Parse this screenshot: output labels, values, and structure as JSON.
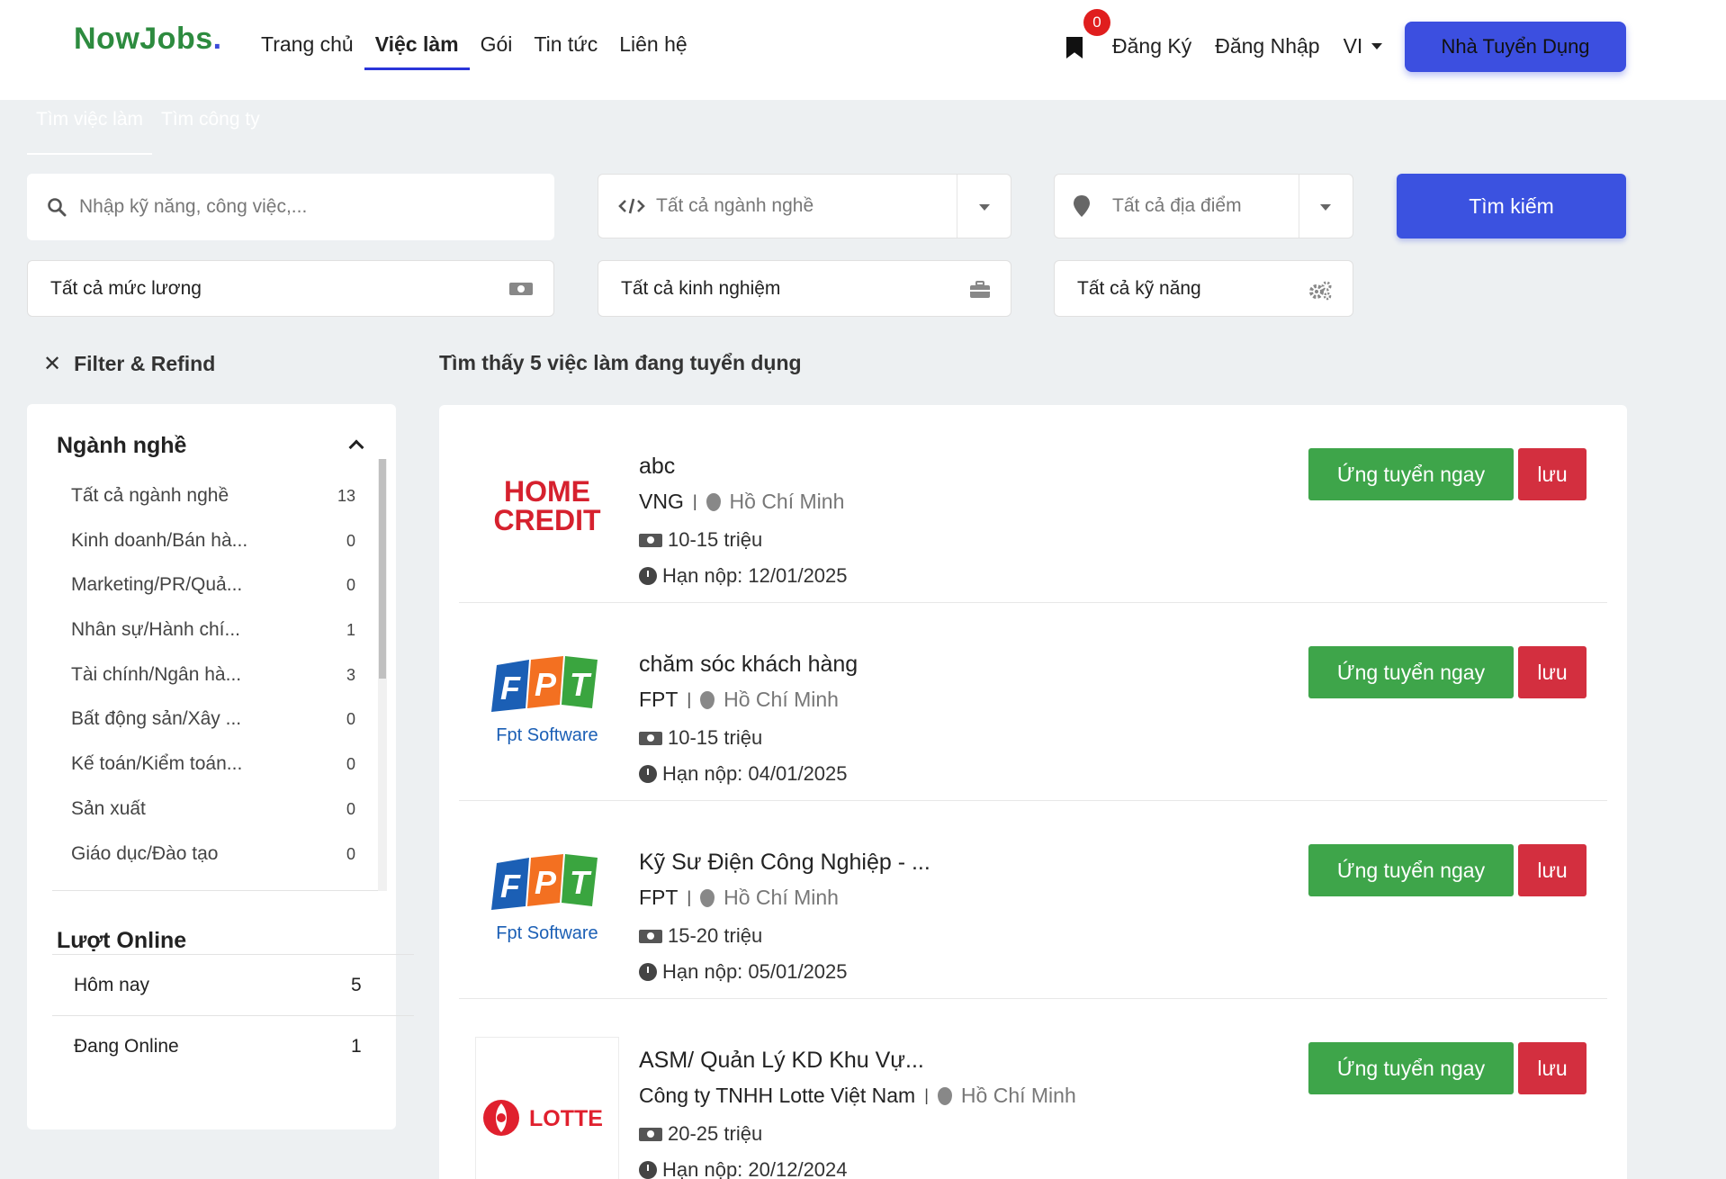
{
  "header": {
    "logo_text": "NowJobs",
    "logo_dot": ".",
    "nav": [
      "Trang chủ",
      "Việc làm",
      "Gói",
      "Tin tức",
      "Liên hệ"
    ],
    "bookmark_count": "0",
    "register": "Đăng Ký",
    "login": "Đăng Nhập",
    "lang": "VI",
    "employer_button": "Nhà Tuyển Dụng"
  },
  "search_tabs": [
    "Tìm việc làm",
    "Tìm công ty"
  ],
  "search": {
    "keyword_placeholder": "Nhập kỹ năng, công việc,...",
    "category": "Tất cả ngành nghề",
    "location": "Tất cả địa điểm",
    "button": "Tìm kiếm",
    "salary": "Tất cả mức lương",
    "experience": "Tất cả kinh nghiệm",
    "skill": "Tất cả kỹ năng"
  },
  "filter_title": "Filter & Refind",
  "result_title": "Tìm thấy 5 việc làm đang tuyển dụng",
  "sidebar": {
    "categories_title": "Ngành nghề",
    "categories": [
      {
        "name": "Tất cả ngành nghề",
        "count": "13"
      },
      {
        "name": "Kinh doanh/Bán hà...",
        "count": "0"
      },
      {
        "name": "Marketing/PR/Quả...",
        "count": "0"
      },
      {
        "name": "Nhân sự/Hành chí...",
        "count": "1"
      },
      {
        "name": "Tài chính/Ngân hà...",
        "count": "3"
      },
      {
        "name": "Bất động sản/Xây ...",
        "count": "0"
      },
      {
        "name": "Kế toán/Kiểm toán...",
        "count": "0"
      },
      {
        "name": "Sản xuất",
        "count": "0"
      },
      {
        "name": "Giáo dục/Đào tạo",
        "count": "0"
      }
    ],
    "online_title": "Lượt Online",
    "online": [
      {
        "name": "Hôm nay",
        "count": "5"
      },
      {
        "name": "Đang Online",
        "count": "1"
      }
    ]
  },
  "jobs": [
    {
      "title": "abc",
      "company": "VNG",
      "location": "Hồ Chí Minh",
      "salary": "10-15 triệu",
      "deadline": "Hạn nộp: 12/01/2025",
      "logo": "homecredit"
    },
    {
      "title": "chăm sóc khách hàng",
      "company": "FPT",
      "location": "Hồ Chí Minh",
      "salary": "10-15 triệu",
      "deadline": "Hạn nộp: 04/01/2025",
      "logo": "fpt"
    },
    {
      "title": "Kỹ Sư Điện Công Nghiệp - ...",
      "company": "FPT",
      "location": "Hồ Chí Minh",
      "salary": "15-20 triệu",
      "deadline": "Hạn nộp: 05/01/2025",
      "logo": "fpt"
    },
    {
      "title": "ASM/ Quản Lý KD Khu Vự...",
      "company": "Công ty TNHH Lotte Việt Nam",
      "location": "Hồ Chí Minh",
      "salary": "20-25 triệu",
      "deadline": "Hạn nộp: 20/12/2024",
      "logo": "lotte"
    }
  ],
  "job_buttons": {
    "apply": "Ứng tuyển ngay",
    "save": "lưu"
  },
  "logos": {
    "homecredit_line1": "HOME",
    "homecredit_line2": "CREDIT",
    "fpt_letters": [
      "F",
      "P",
      "T"
    ],
    "fpt_sub": "Fpt Software",
    "lotte": "LOTTE"
  },
  "colors": {
    "primary": "#3c4fe0",
    "apply": "#3ea54a",
    "save": "#d32f3f",
    "badge": "#e01e1e",
    "logo_green": "#2d8b3f"
  }
}
